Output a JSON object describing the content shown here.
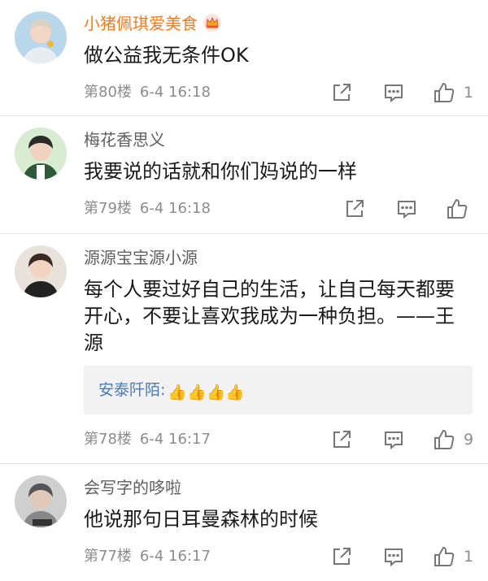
{
  "comments": [
    {
      "name": "小猪佩琪爱美食",
      "text": "做公益我无条件OK",
      "floor": "第80楼",
      "time": "6-4 16:18",
      "likes": "1",
      "vip": true
    },
    {
      "name": "梅花香思义",
      "text": "我要说的话就和你们妈说的一样",
      "floor": "第79楼",
      "time": "6-4 16:18",
      "likes": ""
    },
    {
      "name": "源源宝宝源小源",
      "text_line1": "每个人要过好自己的生活，让自己每天都要",
      "text_line2": "开心，不要让喜欢我成为一种负担。——王",
      "text_line3": "源",
      "reply": {
        "user": "安泰阡陌",
        "separator": ":",
        "emojis": "👍👍👍👍"
      },
      "floor": "第78楼",
      "time": "6-4 16:17",
      "likes": "9"
    },
    {
      "name": "会写字的哆啦",
      "text": "他说那句日耳曼森林的时候",
      "floor": "第77楼",
      "time": "6-4 16:17",
      "likes": "1"
    }
  ],
  "icons": [
    "share-icon",
    "comment-icon",
    "like-icon",
    "vip-crown-icon"
  ],
  "colors": {
    "vip_name": "#f07c1e",
    "name": "#5f5f5f",
    "reply_user": "#4a7ab5",
    "meta": "#8c8c8c",
    "reply_bg": "#f2f2f2"
  }
}
